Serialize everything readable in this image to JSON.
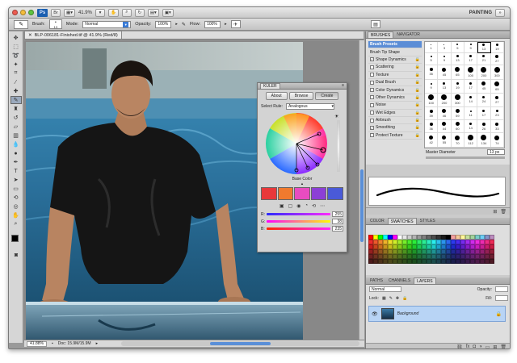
{
  "appbar": {
    "logo": "Ps",
    "zoom": "41.9%",
    "workspace": "PAINTING",
    "icons": [
      "hand-icon",
      "zoom-icon",
      "rotate-icon",
      "grid-icon",
      "arrange-icon",
      "screen-mode-icon"
    ]
  },
  "options": {
    "brush_label": "Brush:",
    "brush_size": "13",
    "mode_label": "Mode:",
    "mode_value": "Normal",
    "opacity_label": "Opacity:",
    "opacity_value": "100%",
    "flow_label": "Flow:",
    "flow_value": "100%"
  },
  "document": {
    "tab_title": "BLP-006181-Finished.tif @ 41.9% (Red/8)"
  },
  "status": {
    "zoom": "41.88%",
    "doc_info": "Doc: 15.9M/15.9M"
  },
  "kuler": {
    "panel_title": "KULER",
    "tabs": [
      "About",
      "Browse",
      "Create"
    ],
    "select_rule_label": "Select Rule:",
    "select_rule_value": "Analogous",
    "base_color_label": "Base Color",
    "swatches": [
      "#e8383a",
      "#f07a2e",
      "#e84cc0",
      "#8c3fd6",
      "#4a5ad8"
    ],
    "sliders": [
      {
        "label": "R:",
        "value": "255",
        "gradient": "linear-gradient(to right,#2a2aff,#ff2aff)"
      },
      {
        "label": "G:",
        "value": "38",
        "gradient": "linear-gradient(to right,#ff00ff,#ffff00)"
      },
      {
        "label": "B:",
        "value": "235",
        "gradient": "linear-gradient(to right,#ff2600,#ff26ff)"
      }
    ]
  },
  "brushes": {
    "tabs": [
      "BRUSHES",
      "NAVIGATOR"
    ],
    "items": [
      {
        "label": "Brush Presets",
        "head": true,
        "checkbox": false,
        "lock": false,
        "checked": false
      },
      {
        "label": "Brush Tip Shape",
        "head": false,
        "checkbox": false,
        "lock": false,
        "checked": false
      },
      {
        "label": "Shape Dynamics",
        "head": false,
        "checkbox": true,
        "lock": true,
        "checked": true
      },
      {
        "label": "Scattering",
        "head": false,
        "checkbox": true,
        "lock": true,
        "checked": false
      },
      {
        "label": "Texture",
        "head": false,
        "checkbox": true,
        "lock": true,
        "checked": false
      },
      {
        "label": "Dual Brush",
        "head": false,
        "checkbox": true,
        "lock": true,
        "checked": false
      },
      {
        "label": "Color Dynamics",
        "head": false,
        "checkbox": true,
        "lock": true,
        "checked": false
      },
      {
        "label": "Other Dynamics",
        "head": false,
        "checkbox": true,
        "lock": true,
        "checked": false
      },
      {
        "label": "Noise",
        "head": false,
        "checkbox": true,
        "lock": true,
        "checked": false
      },
      {
        "label": "Wet Edges",
        "head": false,
        "checkbox": true,
        "lock": true,
        "checked": false
      },
      {
        "label": "Airbrush",
        "head": false,
        "checkbox": true,
        "lock": true,
        "checked": false
      },
      {
        "label": "Smoothing",
        "head": false,
        "checkbox": true,
        "lock": true,
        "checked": true
      },
      {
        "label": "Protect Texture",
        "head": false,
        "checkbox": true,
        "lock": true,
        "checked": false
      }
    ],
    "grid": [
      "1",
      "3",
      "5",
      "9",
      "13",
      "19",
      "5",
      "9",
      "13",
      "17",
      "21",
      "27",
      "35",
      "45",
      "65",
      "100",
      "200",
      "300",
      "9",
      "13",
      "19",
      "17",
      "45",
      "65",
      "100",
      "200",
      "300",
      "14",
      "24",
      "27",
      "39",
      "46",
      "59",
      "11",
      "17",
      "23",
      "36",
      "44",
      "60",
      "14",
      "26",
      "33",
      "42",
      "55",
      "70",
      "112",
      "134",
      "74"
    ],
    "master_label": "Master Diameter",
    "master_value": "13 px"
  },
  "swatch_panel": {
    "tabs": [
      "COLOR",
      "SWATCHES",
      "STYLES"
    ]
  },
  "layers": {
    "tabs": [
      "PATHS",
      "CHANNELS",
      "LAYERS"
    ],
    "blend_mode": "Normal",
    "opacity_label": "Opacity:",
    "lock_label": "Lock:",
    "fill_label": "Fill:",
    "layer_name": "Background"
  }
}
